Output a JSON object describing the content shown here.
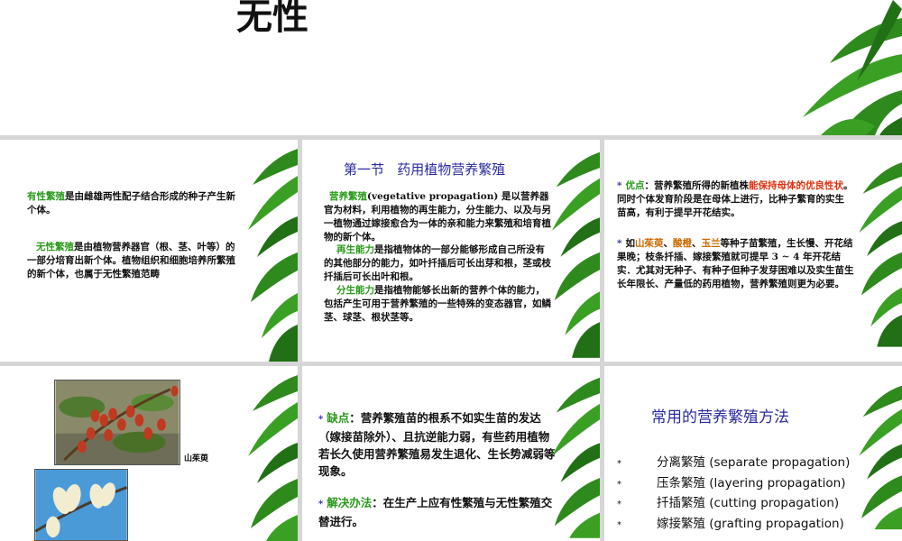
{
  "top": {
    "title": "无性"
  },
  "p1": {
    "para1_term": "有性繁殖",
    "para1_rest": "是由雌雄两性配子结合形成的种子产生新个体。",
    "para2_term": "无性繁殖",
    "para2_rest": "是由植物营养器官（根、茎、叶等）的一部分培育出新个体。植物组织和细胞培养所繁殖的新个体，也属于无性繁殖范畴"
  },
  "p2": {
    "title": "第一节   药用植物营养繁殖",
    "para1_term": "营养繁殖",
    "para1_rest": "(vegetative propagation) 是以营养器官为材料，利用植物的再生能力，分生能力、以及与另一植物通过嫁接愈合为一体的亲和能力来繁殖和培育植物的新个体。",
    "para2_term": "再生能力",
    "para2_rest": "是指植物体的一部分能够形成自己所没有的其他部分的能力，如叶扦插后可长出芽和根，茎或枝扦插后可长出叶和根。",
    "para3_term": "分生能力",
    "para3_rest": "是指植物能够长出新的营养个体的能力，包括产生可用于营养繁殖的一些特殊的变态器官，如鳞茎、球茎、根状茎等。"
  },
  "p3": {
    "b1_label": "优点",
    "b1_a": "：营养繁殖所得的新植株",
    "b1_red": "能保持母体的优良性状",
    "b1_b": "。同时个体发育阶段是在母体上进行，比种子繁育的实生苗高，有利于提早开花结实。",
    "b2_a": "如",
    "b2_p1": "山茱萸",
    "b2_sep1": "、",
    "b2_p2": "酸橙",
    "b2_sep2": "、",
    "b2_p3": "玉兰",
    "b2_b": "等种子苗繁殖，生长慢、开花结果晚；枝条扦插、嫁接繁殖就可提早 3 ~ 4 年开花结实．尤其对无种子、有种子但种子发芽困难以及实生苗生长年限长、产量低的药用植物，营养繁殖则更为必要。"
  },
  "p4": {
    "caption": "山茱萸"
  },
  "p5": {
    "b1_label": "缺点",
    "b1_rest": "：营养繁殖苗的根系不如实生苗的发达（嫁接苗除外）、且抗逆能力弱，有些药用植物若长久使用营养繁殖易发生退化、生长势减弱等现象。",
    "b2_label": "解决办法",
    "b2_rest": "：在生产上应有性繁殖与无性繁殖交替进行。"
  },
  "p6": {
    "title": "常用的营养繁殖方法",
    "items": [
      "分离繁殖 (separate propagation)",
      "压条繁殖 (layering propagation)",
      "扦插繁殖 (cutting propagation)",
      "嫁接繁殖 (grafting propagation)"
    ]
  },
  "colors": {
    "green_term": "#2a9a1a",
    "title_blue": "#2a2aa0",
    "orange": "#cc6a00",
    "red": "#e03010"
  }
}
